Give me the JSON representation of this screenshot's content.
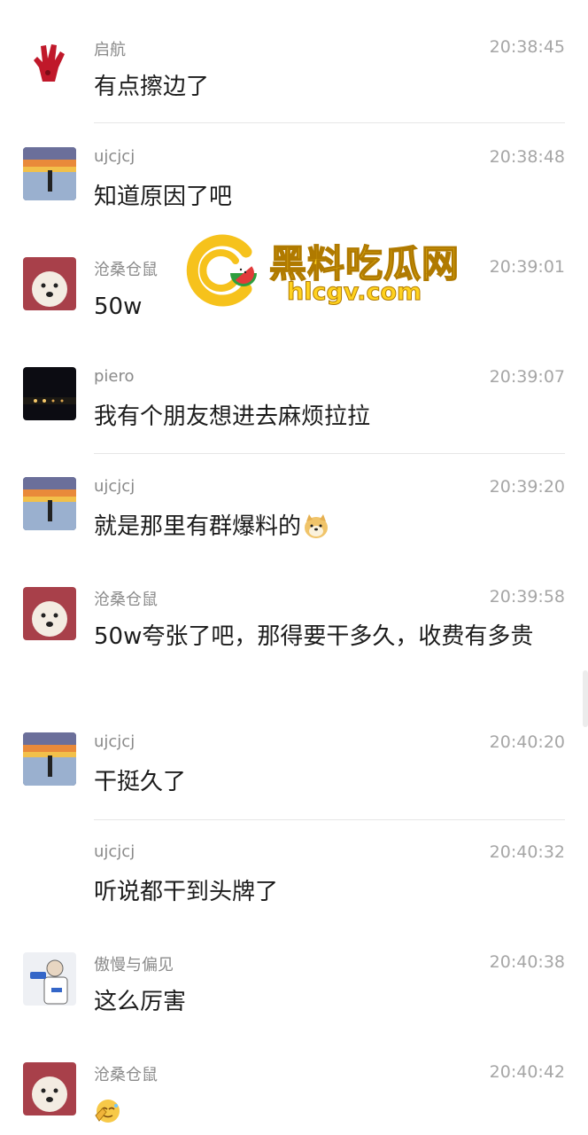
{
  "messages": [
    {
      "name": "启航",
      "time": "20:38:45",
      "text": "有点擦边了",
      "avatar": "red-hand-avatar"
    },
    {
      "name": "ujcjcj",
      "time": "20:38:48",
      "text": "知道原因了吧",
      "avatar": "sunset-avatar"
    },
    {
      "name": "沧桑仓鼠",
      "time": "20:39:01",
      "text": "50w",
      "avatar": "dog-avatar"
    },
    {
      "name": "piero",
      "time": "20:39:07",
      "text": "我有个朋友想进去麻烦拉拉",
      "avatar": "night-road-avatar"
    },
    {
      "name": "ujcjcj",
      "time": "20:39:20",
      "text": "就是那里有群爆料的",
      "avatar": "sunset-avatar",
      "emoji": "doge-emoji"
    },
    {
      "name": "沧桑仓鼠",
      "time": "20:39:58",
      "text": "50w夸张了吧，那得要干多久，收费有多贵",
      "avatar": "dog-avatar"
    },
    {
      "name": "ujcjcj",
      "time": "20:40:20",
      "text": "干挺久了",
      "avatar": "sunset-avatar"
    },
    {
      "name": "ujcjcj",
      "time": "20:40:32",
      "text": "听说都干到头牌了",
      "avatar": "none"
    },
    {
      "name": "傲慢与偏见",
      "time": "20:40:38",
      "text": "这么厉害",
      "avatar": "cartoon-man-avatar"
    },
    {
      "name": "沧桑仓鼠",
      "time": "20:40:42",
      "text": "",
      "avatar": "dog-avatar",
      "emoji": "facepalm-emoji"
    }
  ],
  "watermark": {
    "title": "黑料吃瓜网",
    "url": "hlcgv.com",
    "logo": "watermelon-c-logo-icon"
  },
  "colors": {
    "name": "#8a8a8a",
    "time": "#a6a6a6",
    "text": "#1c1c1c",
    "divider": "#e6e6e6",
    "watermark": "#ffd21f"
  }
}
